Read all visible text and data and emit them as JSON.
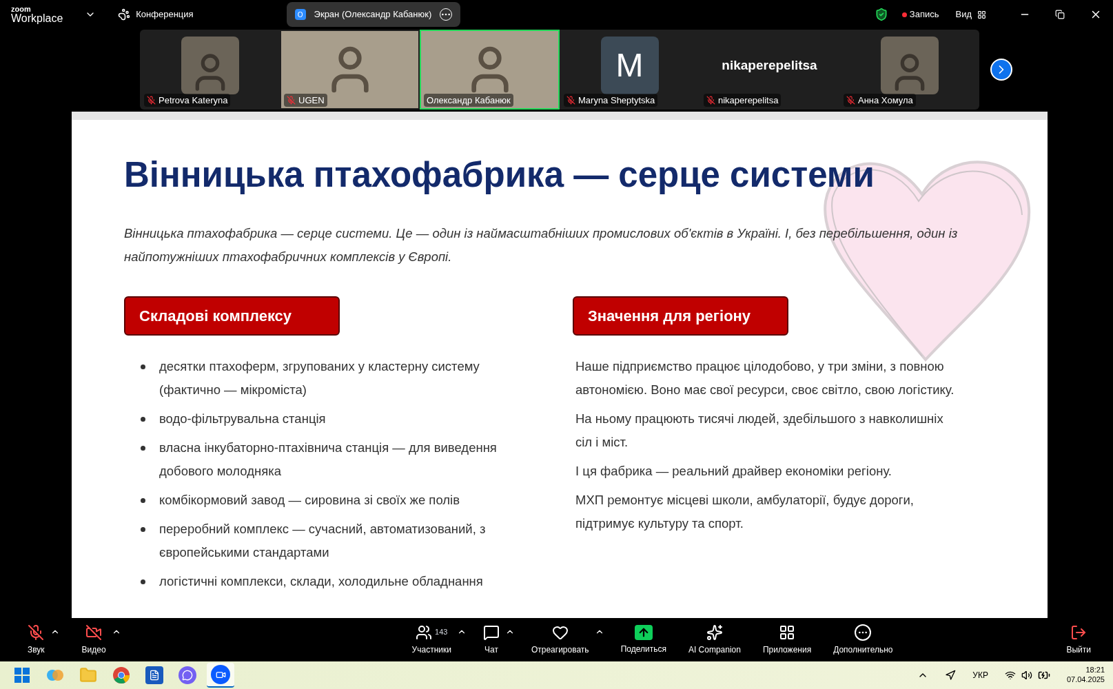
{
  "app": {
    "logo_top": "zoom",
    "logo_bottom": "Workplace"
  },
  "meeting_menu": {
    "label": "Конференция"
  },
  "share_pill": {
    "badge": "O",
    "label": "Экран (Олександр Кабанюк)"
  },
  "recording": {
    "label": "Запись"
  },
  "view": {
    "label": "Вид"
  },
  "participants": [
    {
      "name": "Petrova Kateryna",
      "kind": "photo",
      "muted": true,
      "selected": false
    },
    {
      "name": "UGEN",
      "kind": "video",
      "muted": true,
      "selected": false
    },
    {
      "name": "Олександр Кабанюк",
      "kind": "video",
      "muted": false,
      "selected": true
    },
    {
      "name": "Maryna Sheptytska",
      "kind": "initial",
      "initial": "M",
      "muted": true,
      "selected": false
    },
    {
      "name": "nikaperepelitsa",
      "kind": "name",
      "display": "nikaperepelitsa",
      "muted": true,
      "selected": false
    },
    {
      "name": "Анна Хомула",
      "kind": "photo",
      "muted": true,
      "selected": false
    }
  ],
  "slide": {
    "title": "Вінницька птахофабрика — серце системи",
    "intro": "Вінницька птахофабрика — серце системи. Це — один із наймасштабніших промислових об'єктів в Україні. І, без перебільшення, один із найпотужніших птахофабричних комплексів у Європі.",
    "left": {
      "heading": "Складові комплексу",
      "items": [
        "десятки птахоферм, згрупованих у кластерну систему (фактично — мікроміста)",
        "водо-фільтрувальна станція",
        "власна інкубаторно-птахівнича станція — для виведення добового молодняка",
        "комбікормовий завод — сировина зі своїх же полів",
        "переробний комплекс — сучасний, автоматизований, з європейськими стандартами",
        "логістичні комплекси, склади, холодильне обладнання"
      ]
    },
    "right": {
      "heading": "Значення для регіону",
      "paragraphs": [
        "Наше підприємство працює цілодобово, у три зміни, з повною автономією. Воно має свої ресурси, своє світло, свою логістику.",
        "На ньому працюють тисячі людей, здебільшого з навколишніх сіл і міст.",
        "І ця фабрика — реальний драйвер економіки регіону.",
        "МХП ремонтує місцеві школи, амбулаторії, будує дороги, підтримує культуру та спорт."
      ]
    }
  },
  "toolbar": [
    {
      "kind": "audio",
      "label": "Звук",
      "off": true,
      "caret": true
    },
    {
      "kind": "video",
      "label": "Видео",
      "off": true,
      "caret": true
    },
    {
      "kind": "participants",
      "label": "Участники",
      "count": "143",
      "caret": true
    },
    {
      "kind": "chat",
      "label": "Чат",
      "caret": true
    },
    {
      "kind": "react",
      "label": "Отреагировать",
      "caret": true
    },
    {
      "kind": "share",
      "label": "Поделиться",
      "caret": false
    },
    {
      "kind": "ai",
      "label": "AI Companion",
      "caret": false
    },
    {
      "kind": "apps",
      "label": "Приложения",
      "caret": false
    },
    {
      "kind": "more",
      "label": "Дополнительно",
      "caret": false
    }
  ],
  "leave": {
    "label": "Выйти"
  },
  "taskbar": {
    "apps": [
      {
        "kind": "start",
        "selected": false
      },
      {
        "kind": "copilot",
        "selected": false
      },
      {
        "kind": "folder",
        "selected": false
      },
      {
        "kind": "chrome",
        "selected": false
      },
      {
        "kind": "word",
        "selected": false
      },
      {
        "kind": "viber",
        "selected": false
      },
      {
        "kind": "zoom",
        "selected": true
      }
    ],
    "language": "УКР",
    "time": "18:21",
    "date": "07.04.2025"
  }
}
